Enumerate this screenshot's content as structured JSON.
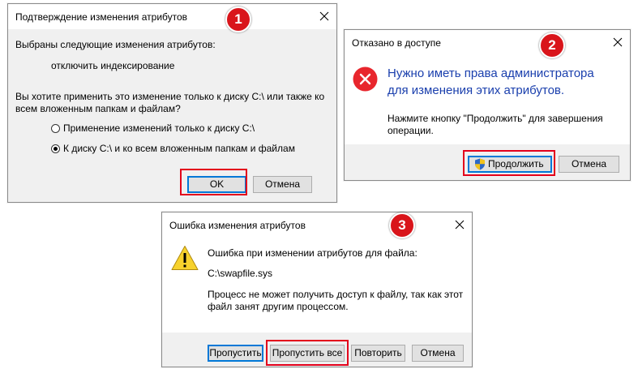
{
  "dialog1": {
    "title": "Подтверждение изменения атрибутов",
    "intro": "Выбраны следующие изменения атрибутов:",
    "change": "отключить индексирование",
    "question_line1": "Вы хотите применить это изменение только к диску C:\\ или также ко",
    "question_line2": "всем вложенным папкам и файлам?",
    "options": [
      {
        "label": "Применение изменений только к диску C:\\",
        "selected": false
      },
      {
        "label": "К диску C:\\ и ко всем вложенным папкам и файлам",
        "selected": true
      }
    ],
    "ok_label": "OK",
    "cancel_label": "Отмена",
    "badge": "1"
  },
  "dialog2": {
    "title": "Отказано в доступе",
    "heading_line1": "Нужно иметь права администратора",
    "heading_line2": "для изменения этих атрибутов.",
    "text_line1": "Нажмите кнопку \"Продолжить\" для завершения",
    "text_line2": "операции.",
    "continue_label": "Продолжить",
    "cancel_label": "Отмена",
    "badge": "2"
  },
  "dialog3": {
    "title": "Ошибка изменения атрибутов",
    "line1": "Ошибка при изменении атрибутов для файла:",
    "file": "C:\\swapfile.sys",
    "text_line1": "Процесс не может получить доступ к файлу, так как этот",
    "text_line2": "файл занят другим процессом.",
    "skip_label": "Пропустить",
    "skip_all_label": "Пропустить все",
    "retry_label": "Повторить",
    "cancel_label": "Отмена",
    "badge": "3"
  },
  "colors": {
    "highlight": "#e3001b",
    "badge": "#d9151b",
    "accent_text": "#1a3fad",
    "default_button": "#0078d7"
  },
  "icons": {
    "close": "close-icon",
    "error": "error-icon",
    "warning": "warning-icon",
    "uac_shield": "uac-shield-icon"
  }
}
